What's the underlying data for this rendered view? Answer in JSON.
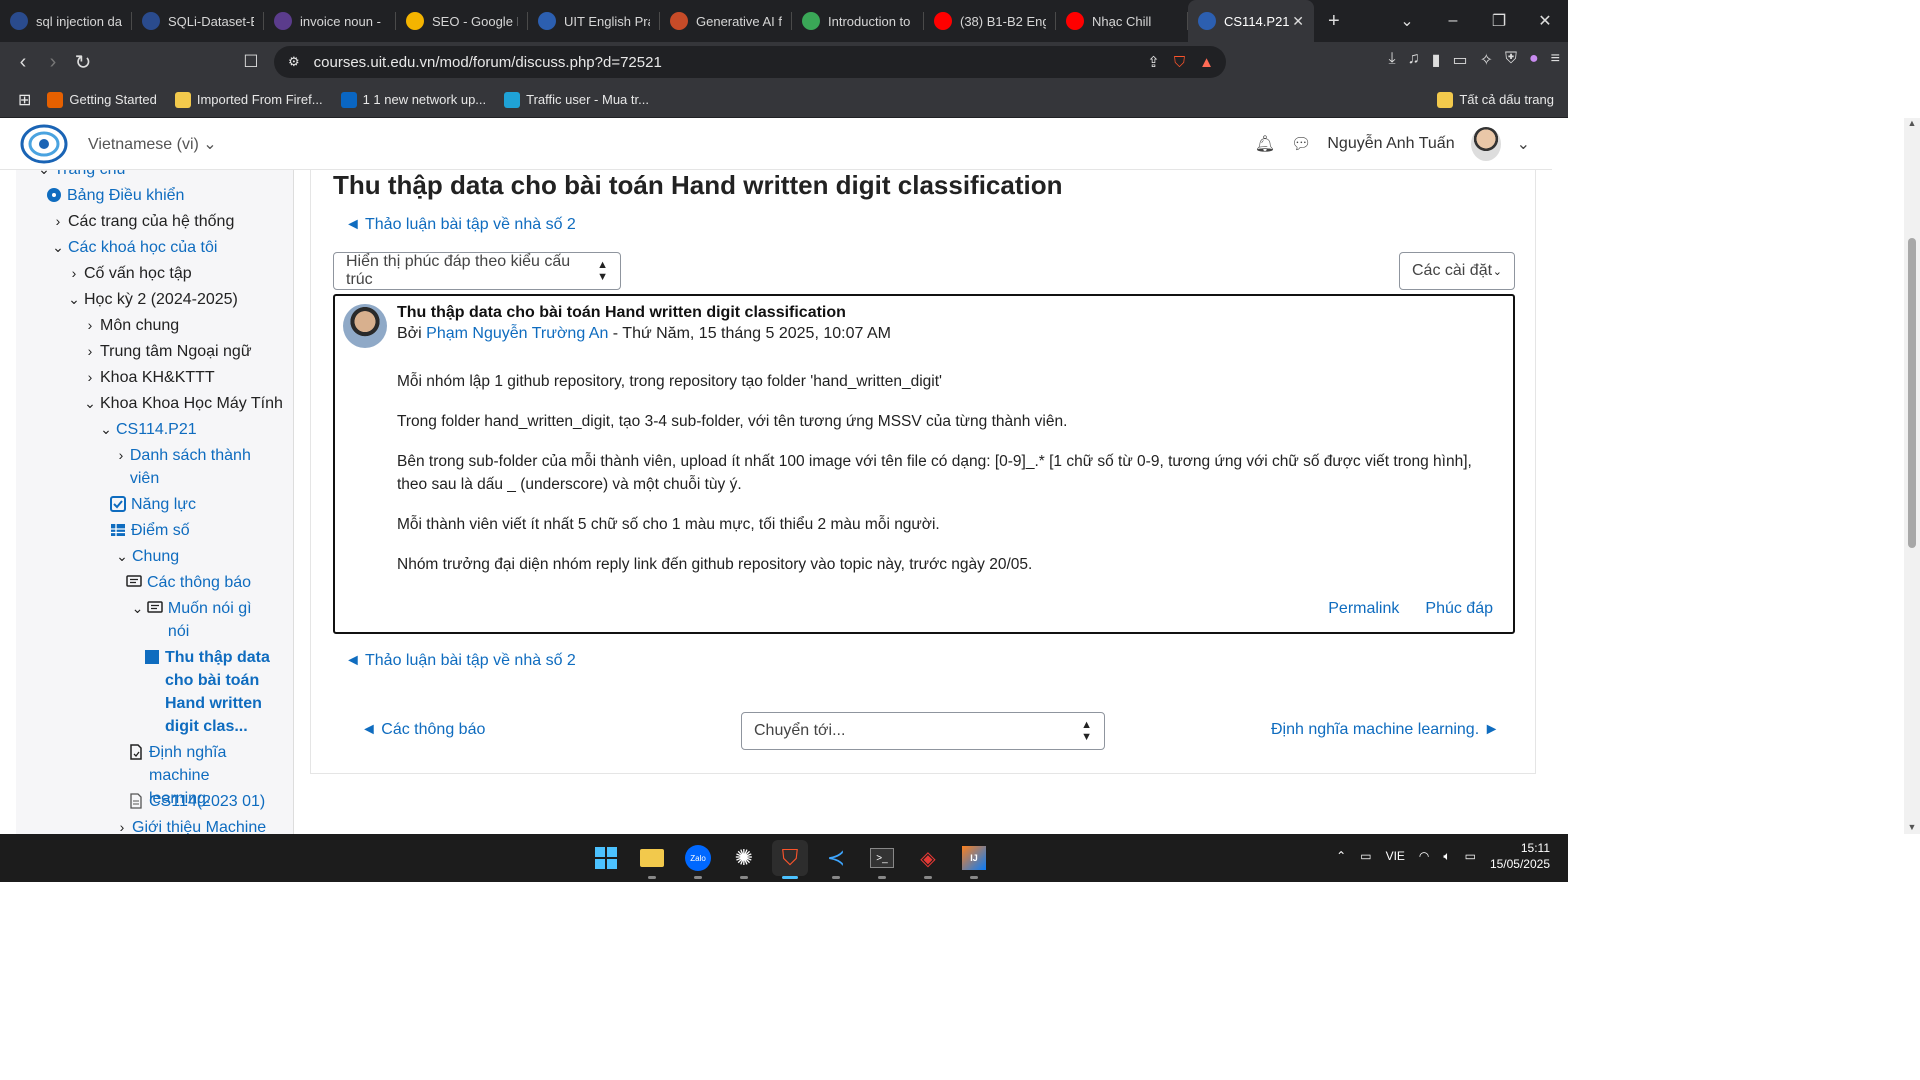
{
  "browser": {
    "tabs": [
      {
        "label": "sql injection da",
        "color": "#2a4b8d"
      },
      {
        "label": "SQLi-Dataset-E",
        "color": "#2a4b8d"
      },
      {
        "label": "invoice noun -",
        "color": "#5b3c8c"
      },
      {
        "label": "SEO - Google I",
        "color": "#f4b400"
      },
      {
        "label": "UIT English Pra",
        "color": "#2c5fb0"
      },
      {
        "label": "Generative AI f",
        "color": "#c64b28"
      },
      {
        "label": "Introduction to",
        "color": "#3aa757"
      },
      {
        "label": "(38) B1-B2 Eng",
        "color": "#ff0000"
      },
      {
        "label": "Nhạc Chill",
        "color": "#ff0000"
      },
      {
        "label": "CS114.P21",
        "color": "#2c5fb0"
      }
    ],
    "url": "courses.uit.edu.vn/mod/forum/discuss.php?d=72521",
    "bookmarks": [
      {
        "label": "Getting Started",
        "color": "#e66000"
      },
      {
        "label": "Imported From Firef...",
        "color": "#f2c94c"
      },
      {
        "label": "1 1 new network up...",
        "color": "#0a66c2"
      },
      {
        "label": "Traffic user - Mua tr...",
        "color": "#1fa2d6"
      }
    ],
    "bookmarks_right": "Tất cả dấu trang"
  },
  "moodle": {
    "language": "Vietnamese ‎(vi)‎",
    "user_name": "Nguyễn Anh Tuấn",
    "drawer": [
      {
        "label": "Trang chủ",
        "link": true
      },
      {
        "label": "Bảng Điều khiển",
        "link": true
      },
      {
        "label": "Các trang của hệ thống",
        "link": false
      },
      {
        "label": "Các khoá học của tôi",
        "link": true
      },
      {
        "label": "Cố vấn học tập",
        "link": false
      },
      {
        "label": "Học kỳ 2 (2024-2025)",
        "link": false
      },
      {
        "label": "Môn chung",
        "link": false
      },
      {
        "label": "Trung tâm Ngoại ngữ",
        "link": false
      },
      {
        "label": "Khoa KH&KTTT",
        "link": false
      },
      {
        "label": "Khoa Khoa Học Máy Tính",
        "link": false
      },
      {
        "label": "CS114.P21",
        "link": true
      },
      {
        "label": "Danh sách thành viên",
        "link": true
      },
      {
        "label": "Năng lực",
        "link": true
      },
      {
        "label": "Điểm số",
        "link": true
      },
      {
        "label": "Chung",
        "link": true
      },
      {
        "label": "Các thông báo",
        "link": true
      },
      {
        "label": "Muốn nói gì nói",
        "link": true
      },
      {
        "label": "Thu thập data cho bài toán Hand written digit clas...",
        "link": true
      },
      {
        "label": "Định nghĩa machine learning.",
        "link": true
      },
      {
        "label": "CS114(2023 01)",
        "link": true
      },
      {
        "label": "Giới thiệu Machine",
        "link": true
      }
    ],
    "page_title": "Thu thập data cho bài toán Hand written digit classification",
    "back_link": "◄ Thảo luận bài tập về nhà số 2",
    "display_mode": "Hiển thị phúc đáp theo kiểu cấu trúc",
    "settings": "Các cài đặt",
    "post": {
      "subject": "Thu thập data cho bài toán Hand written digit classification",
      "by": "Bởi",
      "author": "Phạm Nguyễn Trường An",
      "date": " - Thứ Năm, 15 tháng 5 2025, 10:07 AM",
      "paragraphs": [
        "Mỗi nhóm lập 1 github repository, trong repository tạo folder 'hand_written_digit'",
        "Trong folder hand_written_digit, tạo 3-4 sub-folder, với tên tương ứng MSSV của từng thành viên.",
        "Bên trong sub-folder của mỗi thành viên, upload ít nhất 100 image với tên file có dạng: [0-9]_.* [1 chữ số từ 0-9, tương ứng với chữ số được viết trong hình], theo sau là dấu _ (underscore) và một chuỗi tùy ý.",
        "Mỗi thành viên viết ít nhất 5 chữ số cho 1 màu mực, tối thiểu 2 màu mỗi người.",
        "Nhóm trưởng đại diện nhóm reply link đến github repository vào topic này, trước ngày 20/05."
      ],
      "permalink": "Permalink",
      "reply": "Phúc đáp"
    },
    "prev_activity": "◄ Các thông báo",
    "jump_to": "Chuyển tới...",
    "next_activity": "Định nghĩa machine learning. ►"
  },
  "taskbar": {
    "language": "VIE",
    "time": "15:11",
    "date": "15/05/2025"
  }
}
